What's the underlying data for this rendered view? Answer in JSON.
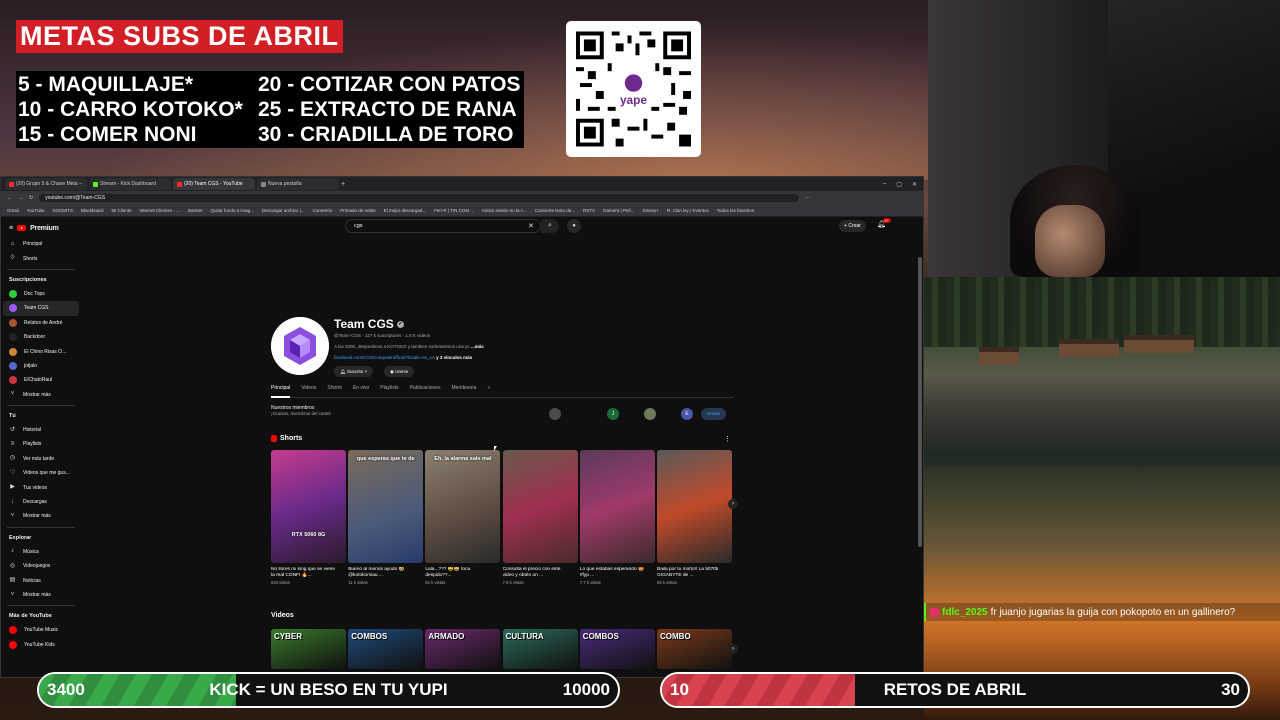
{
  "overlay": {
    "goals_title": "METAS SUBS DE ABRIL",
    "goals": [
      {
        "left": "5 -   MAQUILLAJE*",
        "right": "20 - COTIZAR CON PATOS"
      },
      {
        "left": "10 - CARRO KOTOKO*",
        "right": "25 - EXTRACTO DE RANA"
      },
      {
        "left": "15 - COMER NONI",
        "right": "30 - CRIADILLA DE TORO"
      }
    ],
    "qr_brand": "yape"
  },
  "chat": {
    "user": "fdlc_2025",
    "message": "fr juanjo jugarias la guija con pokopoto en un gallinero?"
  },
  "bars": {
    "left": {
      "start": "3400",
      "label": "KICK = UN BESO EN TU YUPI",
      "end": "10000",
      "progress": 0.34,
      "color": "#3aa94a"
    },
    "right": {
      "start": "10",
      "label": "RETOS DE ABRIL",
      "end": "30",
      "progress": 0.33,
      "color": "#d9434f"
    }
  },
  "browser": {
    "tabs": [
      {
        "title": "(20) Grupo 5 & Chane Meta – ",
        "color": "#ff2b2b"
      },
      {
        "title": "Stream - Kick Dashboard",
        "color": "#53fc18"
      },
      {
        "title": "(20) Team CGS - YouTube",
        "color": "#ff2b2b"
      },
      {
        "title": "Nueva pestaña",
        "color": "#888888"
      }
    ],
    "url": "youtube.com/@Team-CGS",
    "bookmarks": [
      "Gmail",
      "YouTube",
      "SOCMITS",
      "Blackboard",
      "Mi Cliente",
      "Internet Clientes - ...",
      "Banner",
      "Quitar fondo a imag...",
      "Descargar archivo |...",
      "Cometrón",
      "Primado de notas",
      "El mejor descargad...",
      "Feri-R | TIN.COM ...",
      "Iniciar sesión en la c...",
      "Convierte texto de...",
      "RSTV",
      "Gamera | Pelí...",
      "Disney+",
      "R. Clan ley | Eventos",
      "Todos los favoritos"
    ]
  },
  "youtube": {
    "logo_text": "Premium",
    "search_value": "cgs",
    "create_label": "Crear",
    "notif_count": "9+",
    "sidebar": {
      "main": [
        {
          "label": "Principal",
          "icon": "⌂"
        },
        {
          "label": "Shorts",
          "icon": "⟐"
        }
      ],
      "subs_title": "Suscripciones",
      "subs": [
        {
          "label": "Doc Tops",
          "color": "#2ecc40"
        },
        {
          "label": "Team CGS",
          "color": "#9b59ff"
        },
        {
          "label": "Relatos de André",
          "color": "#aa5533"
        },
        {
          "label": "Backdoor",
          "color": "#222222"
        },
        {
          "label": "El Chino Risas O...",
          "color": "#cc8833"
        },
        {
          "label": "jotjalo",
          "color": "#5566cc"
        },
        {
          "label": "ElChatoRaul",
          "color": "#cc3344"
        }
      ],
      "subs_more": "Mostrar más",
      "you_title": "Tú",
      "you": [
        {
          "label": "Historial",
          "icon": "↺"
        },
        {
          "label": "Playlists",
          "icon": "≡"
        },
        {
          "label": "Ver más tarde",
          "icon": "◷"
        },
        {
          "label": "Videos que me gus...",
          "icon": "♡"
        },
        {
          "label": "Tus videos",
          "icon": "▶"
        },
        {
          "label": "Descargas",
          "icon": "↓"
        },
        {
          "label": "Mostrar más",
          "icon": "˅"
        }
      ],
      "explore_title": "Explorar",
      "explore": [
        {
          "label": "Música",
          "icon": "♪"
        },
        {
          "label": "Videojuegos",
          "icon": "◎"
        },
        {
          "label": "Noticias",
          "icon": "▤"
        },
        {
          "label": "Mostrar más",
          "icon": "˅"
        }
      ],
      "more_title": "Más de YouTube",
      "more": [
        {
          "label": "YouTube Music",
          "color": "#ff0000"
        },
        {
          "label": "YouTube Kids",
          "color": "#ff0000"
        }
      ]
    },
    "channel": {
      "name": "Team CGS",
      "meta": "@Team-CGS · 127 k suscriptores · 1.8 K videos",
      "desc": "A los 200K, despedimos a KOTOKO y tambien sorteraremos una pc",
      "desc_more": "...más",
      "link": "facebook.com/CGSComputerofficial?locale=es_LA",
      "link_more": "y 3 vínculos más",
      "subscribed_label": "Suscrito",
      "join_label": "Unirse",
      "tabs": [
        "Principal",
        "Videos",
        "Shorts",
        "En vivo",
        "Playlists",
        "Publicaciones",
        "Membresía"
      ],
      "members_title": "Nuestros miembros",
      "members_sub": "¡Gracias, miembros del canal!",
      "member_initials": [
        "",
        "J",
        "",
        "E"
      ],
      "members_join": "Unirse"
    },
    "shorts_title": "Shorts",
    "shorts": [
      {
        "title": "No llores mi king que se viene la real CONFI 🔥...",
        "views": "534 vistas",
        "caption": "RTX 5060 8G"
      },
      {
        "title": "Bueno al menos ayudó 🤣 @kotokomiau ...",
        "views": "11 k vistas",
        "caption": "que esperas que te de"
      },
      {
        "title": "Lala...??? 😅😅 toca despido??...",
        "views": "61 k vistas",
        "caption": "Eh, la alarma sale mal"
      },
      {
        "title": "Consulta el precio con este video y obtén un ...",
        "views": "7.9 k vistas",
        "caption": ""
      },
      {
        "title": "Lo que estabas esperando 😍 #fyp ...",
        "views": "7.7 k vistas",
        "caption": ""
      },
      {
        "title": "Baila por tu moño!! La 5070ti GIGABYTE de ...",
        "views": "55 k vistas",
        "caption": ""
      }
    ],
    "videos_title": "Videos",
    "videos": [
      {
        "label": "CYBER",
        "color": "#3a7a2a"
      },
      {
        "label": "COMBOS",
        "color": "#1f4a7a"
      },
      {
        "label": "ARMADO",
        "color": "#6a2a6a"
      },
      {
        "label": "CULTURA",
        "color": "#2a6a5a"
      },
      {
        "label": "COMBOS",
        "color": "#4a2a7a"
      },
      {
        "label": "COMBO",
        "color": "#7a3a1a"
      }
    ]
  }
}
